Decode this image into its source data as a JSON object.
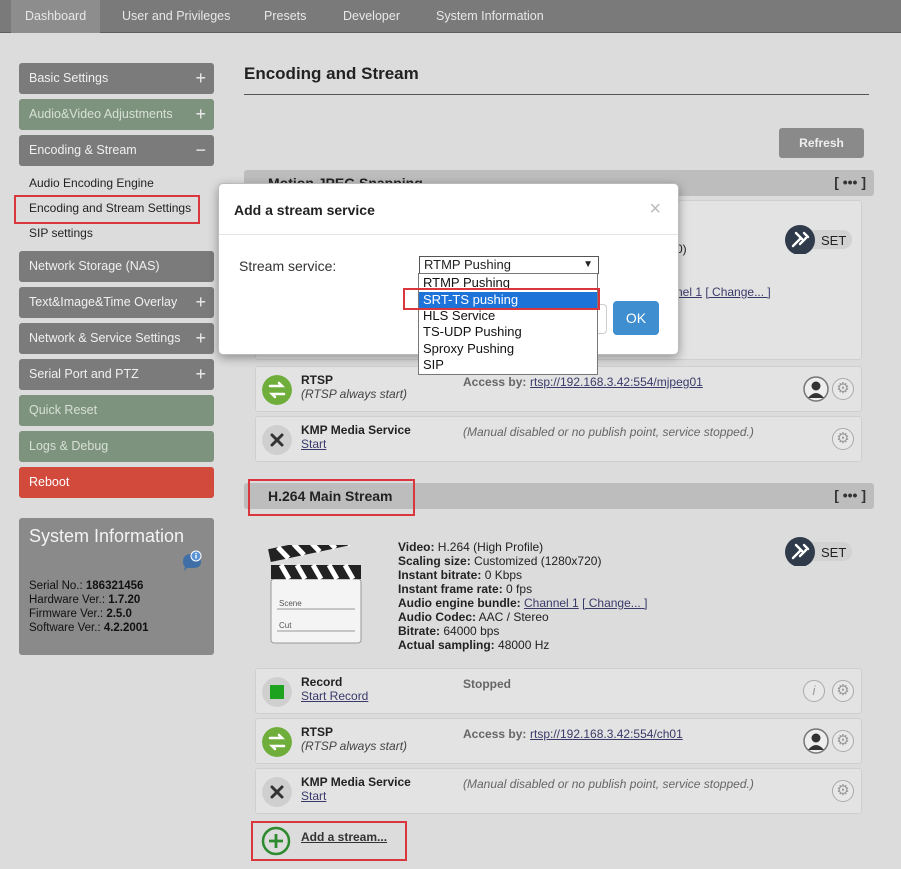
{
  "topnav": {
    "tabs": [
      "Dashboard",
      "User and Privileges",
      "Presets",
      "Developer",
      "System Information"
    ]
  },
  "sidebar": {
    "items": [
      {
        "label": "Basic Settings",
        "toggle": "+"
      },
      {
        "label": "Audio&Video Adjustments",
        "toggle": "+"
      },
      {
        "label": "Encoding & Stream",
        "toggle": "−"
      },
      {
        "label": "Network Storage (NAS)",
        "toggle": ""
      },
      {
        "label": "Text&Image&Time Overlay",
        "toggle": "+"
      },
      {
        "label": "Network & Service Settings",
        "toggle": "+"
      },
      {
        "label": "Serial Port and PTZ",
        "toggle": "+"
      },
      {
        "label": "Quick Reset",
        "toggle": ""
      },
      {
        "label": "Logs & Debug",
        "toggle": ""
      },
      {
        "label": "Reboot",
        "toggle": ""
      }
    ],
    "subitems": [
      "Audio Encoding Engine",
      "Encoding and Stream Settings",
      "SIP settings"
    ]
  },
  "sysinfo": {
    "title": "System Information",
    "serial_label": "Serial No.:",
    "serial": "186321456",
    "hw_label": "Hardware Ver.:",
    "hw": "1.7.20",
    "fw_label": "Firmware Ver.:",
    "fw": "2.5.0",
    "sw_label": "Software Ver.:",
    "sw": "4.2.2001"
  },
  "main": {
    "title": "Encoding and Stream",
    "refresh": "Refresh",
    "dots": "[ ••• ]",
    "set": "SET",
    "mjpeg_section": "Motion JPEG Snapping",
    "mjpeg_partial_1": "0)",
    "mjpeg_partial_channel": "nel 1",
    "mjpeg_partial_change": "[ Change... ]",
    "mjpeg_rtsp_name": "RTSP",
    "mjpeg_rtsp_sub": "(RTSP always start)",
    "mjpeg_rtsp_access_label": "Access by:",
    "mjpeg_rtsp_url": "rtsp://192.168.3.42:554/mjpeg01",
    "mjpeg_kmp_name": "KMP Media Service",
    "mjpeg_kmp_start": "Start",
    "mjpeg_kmp_note": "(Manual disabled or no publish point, service stopped.)",
    "h264_section": "H.264 Main Stream",
    "h264_details": {
      "video_label": "Video:",
      "video": "H.264 (High Profile)",
      "scaling_label": "Scaling size:",
      "scaling": "Customized (1280x720)",
      "bitrate_label": "Instant bitrate:",
      "bitrate": "0 Kbps",
      "frame_label": "Instant frame rate:",
      "frame": "0 fps",
      "bundle_label": "Audio engine bundle:",
      "bundle": "Channel 1",
      "change": "[ Change... ]",
      "codec_label": "Audio Codec:",
      "codec": "AAC / Stereo",
      "bitrate2_label": "Bitrate:",
      "bitrate2": "64000 bps",
      "sampling_label": "Actual sampling:",
      "sampling": "48000 Hz"
    },
    "clapper_scene": "Scene",
    "clapper_cut": "Cut",
    "record_name": "Record",
    "record_link": "Start Record",
    "record_status": "Stopped",
    "rtsp_name": "RTSP",
    "rtsp_sub": "(RTSP always start)",
    "rtsp_access_label": "Access by:",
    "rtsp_url": "rtsp://192.168.3.42:554/ch01",
    "kmp_name": "KMP Media Service",
    "kmp_start": "Start",
    "kmp_note": "(Manual disabled or no publish point, service stopped.)",
    "add_stream": "Add a stream..."
  },
  "modal": {
    "title": "Add a stream service",
    "close": "×",
    "label": "Stream service:",
    "selected": "RTMP Pushing",
    "ok": "OK",
    "options": [
      "RTMP Pushing",
      "SRT-TS pushing",
      "HLS Service",
      "TS-UDP Pushing",
      "Sproxy Pushing",
      "SIP"
    ],
    "highlighted_index": 1
  },
  "colors": {
    "accent": "#3e8ed0",
    "highlight_box": "#d9363e",
    "reboot": "#d14a3c"
  }
}
